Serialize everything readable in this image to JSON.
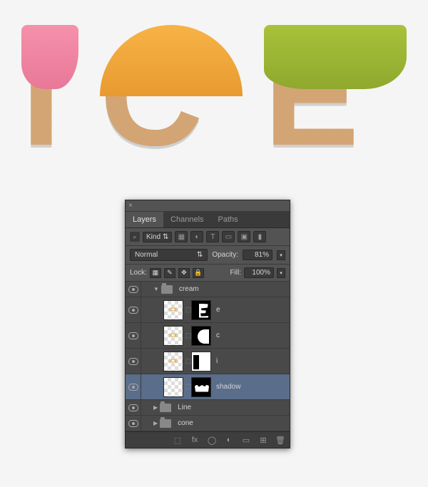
{
  "artwork": {
    "text": "ICE",
    "letters": [
      "I",
      "C",
      "E"
    ]
  },
  "panel": {
    "tabs": {
      "layers": "Layers",
      "channels": "Channels",
      "paths": "Paths"
    },
    "filter": {
      "kind_label": "Kind"
    },
    "blend": {
      "mode": "Normal",
      "opacity_label": "Opacity:",
      "opacity_value": "81%"
    },
    "lock": {
      "label": "Lock:",
      "fill_label": "Fill:",
      "fill_value": "100%"
    },
    "layers": {
      "cream": "cream",
      "e": "e",
      "c": "c",
      "i": "i",
      "shadow": "shadow",
      "line": "Line",
      "cone": "cone"
    }
  }
}
